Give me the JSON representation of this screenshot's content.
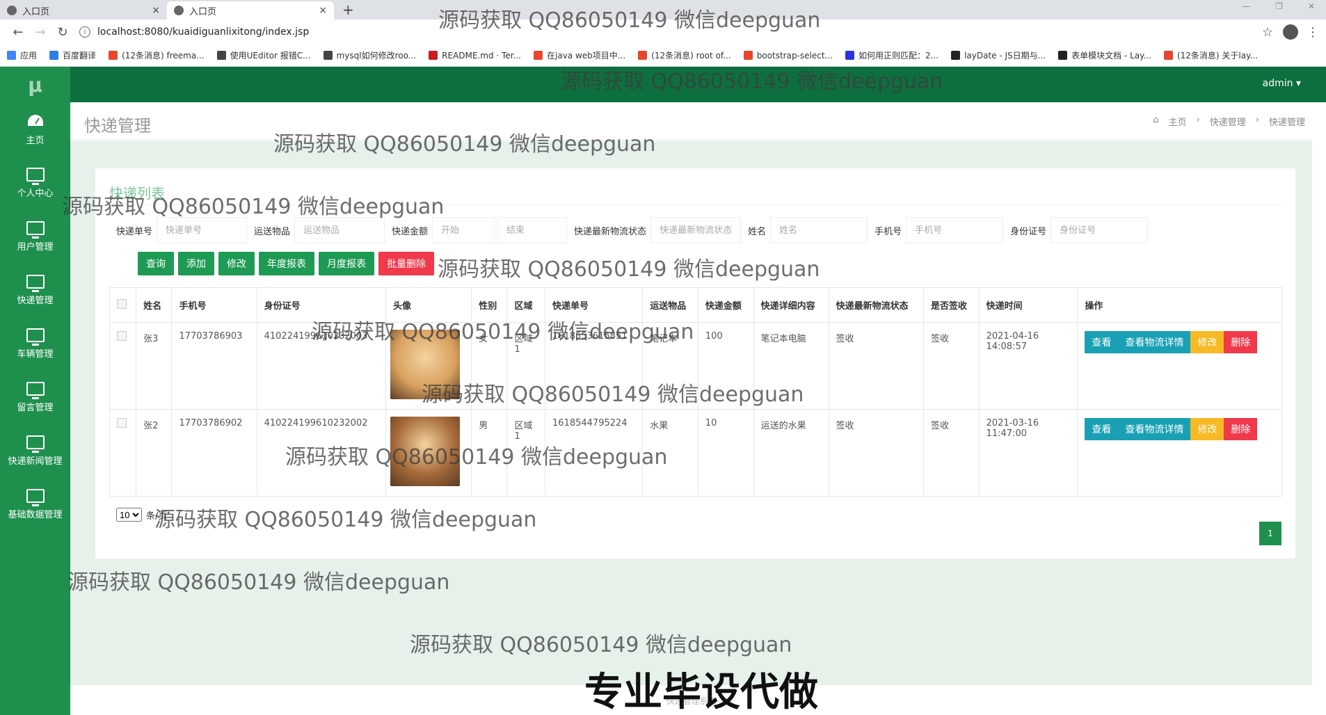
{
  "browser": {
    "tabs": [
      {
        "title": "入口页",
        "active": false
      },
      {
        "title": "入口页",
        "active": true
      }
    ],
    "tab_close": "×",
    "new_tab": "+",
    "url": "localhost:8080/kuaidiguanlixitong/index.jsp",
    "bookmarks": [
      {
        "label": "应用",
        "color": "#4285f4"
      },
      {
        "label": "百度翻译",
        "color": "#2b7de9"
      },
      {
        "label": "(12条消息) freema...",
        "color": "#e8452c"
      },
      {
        "label": "使用UEditor 报错C...",
        "color": "#444444"
      },
      {
        "label": "mysql如何修改roo...",
        "color": "#444444"
      },
      {
        "label": "README.md · Ter...",
        "color": "#c71d23"
      },
      {
        "label": "在java web项目中...",
        "color": "#e8452c"
      },
      {
        "label": "(12条消息) root of...",
        "color": "#e8452c"
      },
      {
        "label": "bootstrap-select...",
        "color": "#e8452c"
      },
      {
        "label": "如何用正则匹配：2...",
        "color": "#2932e1"
      },
      {
        "label": "layDate - JS日期与...",
        "color": "#222222"
      },
      {
        "label": "表单模块文档 - Lay...",
        "color": "#222222"
      },
      {
        "label": "(12条消息) 关于lay...",
        "color": "#e8452c"
      }
    ]
  },
  "sidebar": {
    "logo": "μ",
    "items": [
      {
        "label": "主页",
        "icon": "dashboard-icon"
      },
      {
        "label": "个人中心",
        "icon": "monitor-icon"
      },
      {
        "label": "用户管理",
        "icon": "monitor-icon"
      },
      {
        "label": "快递管理",
        "icon": "monitor-icon"
      },
      {
        "label": "车辆管理",
        "icon": "monitor-icon"
      },
      {
        "label": "留言管理",
        "icon": "monitor-icon"
      },
      {
        "label": "快递新闻管理",
        "icon": "monitor-icon"
      },
      {
        "label": "基础数据管理",
        "icon": "monitor-icon"
      }
    ]
  },
  "topbar": {
    "user": "admin ▾"
  },
  "header": {
    "title": "快递管理",
    "breadcrumb": [
      "主页",
      "›",
      "快递管理",
      "›",
      "快递管理"
    ]
  },
  "panel": {
    "title": "快递列表",
    "filters": [
      {
        "label": "快递单号",
        "placeholder": "快递单号",
        "width": 130
      },
      {
        "label": "运送物品",
        "placeholder": "运送物品",
        "width": 130
      },
      {
        "label": "快递金额",
        "placeholder": "开始",
        "width": 90
      },
      {
        "label": "",
        "placeholder": "结束",
        "width": 100
      },
      {
        "label": "快递最新物流状态",
        "placeholder": "快递最新物流状态",
        "width": 130
      },
      {
        "label": "姓名",
        "placeholder": "姓名",
        "width": 140
      },
      {
        "label": "手机号",
        "placeholder": "手机号",
        "width": 140
      },
      {
        "label": "身份证号",
        "placeholder": "身份证号",
        "width": 140
      }
    ],
    "buttons": {
      "query": "查询",
      "add": "添加",
      "edit": "修改",
      "year_report": "年度报表",
      "month_report": "月度报表",
      "batch_delete": "批量删除"
    },
    "columns": [
      "姓名",
      "手机号",
      "身份证号",
      "头像",
      "性别",
      "区域",
      "快递单号",
      "运送物品",
      "快递金额",
      "快递详细内容",
      "快递最新物流状态",
      "是否签收",
      "快递时间",
      "操作"
    ],
    "rows": [
      {
        "name": "张3",
        "phone": "17703786903",
        "id_card": "410224199610232003",
        "avatar_color": "#d9a15f",
        "gender": "女",
        "region": "区域1",
        "tracking_no": "1618553615851",
        "item": "笔记本",
        "amount": "100",
        "detail": "笔记本电脑",
        "status": "签收",
        "signed": "签收",
        "time": "2021-04-16 14:08:57"
      },
      {
        "name": "张2",
        "phone": "17703786902",
        "id_card": "410224199610232002",
        "avatar_color": "#a66a3a",
        "gender": "男",
        "region": "区域1",
        "tracking_no": "1618544795224",
        "item": "水果",
        "amount": "10",
        "detail": "运送的水果",
        "status": "签收",
        "signed": "签收",
        "time": "2021-03-16 11:47:00"
      }
    ],
    "row_ops": {
      "view": "查看",
      "logistics": "查看物流详情",
      "edit": "修改",
      "delete": "删除"
    },
    "page_size": "10",
    "page_size_suffix": "条/页",
    "current_page": "1"
  },
  "watermark": "源码获取 QQ86050149 微信deepguan",
  "banner": "专业毕设代做",
  "footer": "快递管理系统"
}
